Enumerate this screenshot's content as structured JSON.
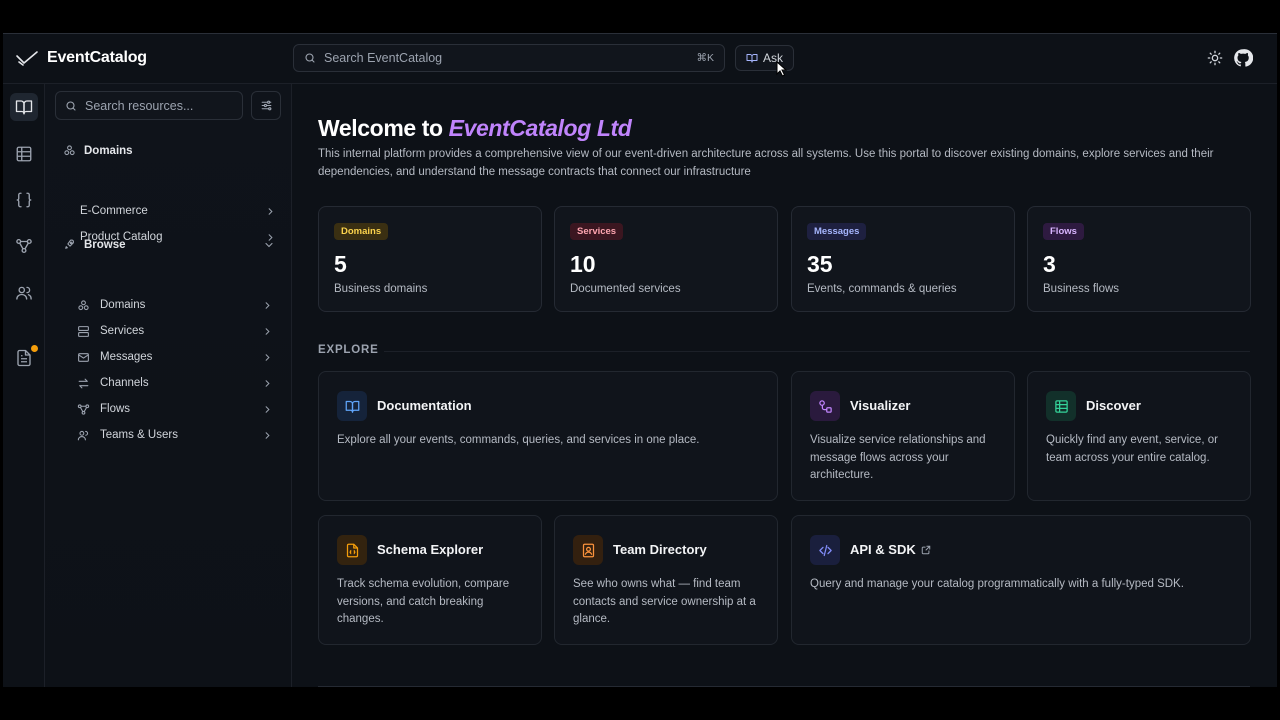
{
  "app": {
    "name": "EventCatalog"
  },
  "topbar": {
    "search_placeholder": "Search EventCatalog",
    "search_shortcut": "⌘K",
    "ask_label": "Ask"
  },
  "sidebar": {
    "search_placeholder": "Search resources...",
    "domains_group": {
      "title": "Domains",
      "items": [
        {
          "label": "E-Commerce"
        },
        {
          "label": "Product Catalog"
        }
      ]
    },
    "browse_group": {
      "title": "Browse",
      "items": [
        {
          "label": "Domains",
          "icon": "domains-icon"
        },
        {
          "label": "Services",
          "icon": "server-icon"
        },
        {
          "label": "Messages",
          "icon": "mail-icon"
        },
        {
          "label": "Channels",
          "icon": "arrows-icon"
        },
        {
          "label": "Flows",
          "icon": "flow-icon"
        },
        {
          "label": "Teams & Users",
          "icon": "users-icon"
        }
      ]
    }
  },
  "main": {
    "welcome_prefix": "Welcome to",
    "welcome_brand": "EventCatalog Ltd",
    "intro": "This internal platform provides a comprehensive view of our event-driven architecture across all systems. Use this portal to discover existing domains, explore services and their dependencies, and understand the message contracts that connect our infrastructure",
    "stats": [
      {
        "tag": "Domains",
        "value": "5",
        "label": "Business domains",
        "color": "#fcd34d",
        "bg": "#3a2f12"
      },
      {
        "tag": "Services",
        "value": "10",
        "label": "Documented services",
        "color": "#fda4af",
        "bg": "#3b1620"
      },
      {
        "tag": "Messages",
        "value": "35",
        "label": "Events, commands & queries",
        "color": "#a5b4fc",
        "bg": "#1e2040"
      },
      {
        "tag": "Flows",
        "value": "3",
        "label": "Business flows",
        "color": "#d8b4fe",
        "bg": "#2e1a40"
      }
    ],
    "explore_title": "EXPLORE",
    "cards": [
      {
        "title": "Documentation",
        "desc": "Explore all your events, commands, queries, and services in one place.",
        "icon": "book-icon"
      },
      {
        "title": "Visualizer",
        "desc": "Visualize service relationships and message flows across your architecture.",
        "icon": "visualizer-icon"
      },
      {
        "title": "Discover",
        "desc": "Quickly find any event, service, or team across your entire catalog.",
        "icon": "table-icon"
      },
      {
        "title": "Schema Explorer",
        "desc": "Track schema evolution, compare versions, and catch breaking changes.",
        "icon": "schema-file-icon"
      },
      {
        "title": "Team Directory",
        "desc": "See who owns what — find team contacts and service ownership at a glance.",
        "icon": "contact-icon"
      },
      {
        "title": "API & SDK",
        "desc": "Query and manage your catalog programmatically with a fully-typed SDK.",
        "icon": "code-icon"
      }
    ]
  }
}
